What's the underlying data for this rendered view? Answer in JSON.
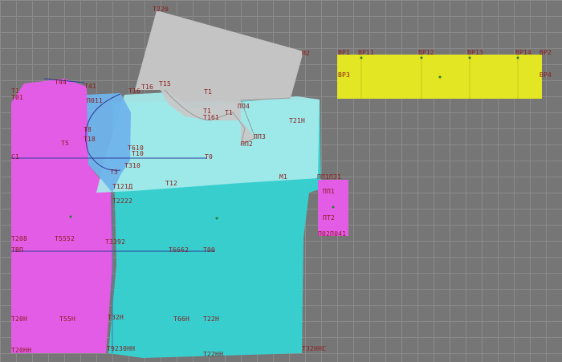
{
  "colors": {
    "background": "#767676",
    "grid": "#8a8a8a",
    "magenta_piece": "#e35ce6",
    "cyan_piece": "#35d3d3",
    "light_cyan_piece": "#a6ecec",
    "blue_piece": "#6fb4ec",
    "gray_piece": "#c8c8c8",
    "yellow_piece": "#e3e622",
    "point_label": "#8b1a1a"
  },
  "pieces": [
    {
      "id": "front-left",
      "color": "magenta"
    },
    {
      "id": "back-center",
      "color": "cyan"
    },
    {
      "id": "sleeve-overlay",
      "color": "light-cyan"
    },
    {
      "id": "armhole-region",
      "color": "blue"
    },
    {
      "id": "collar-piece",
      "color": "gray"
    },
    {
      "id": "belt-strip",
      "color": "yellow"
    },
    {
      "id": "pocket-piece",
      "color": "magenta"
    }
  ],
  "labels": {
    "t220": "Т220",
    "m2": "М2",
    "bp1": "ВР1",
    "bp11": "ВР11",
    "bp12": "ВР12",
    "bp13": "ВР13",
    "bp14": "ВР14",
    "bp2": "ВР2",
    "bp3": "ВР3",
    "bp4": "ВР4",
    "t44": "Т44",
    "t1": "Т1",
    "t01": "Т01",
    "t41": "Т41",
    "p011": "П011",
    "t16": "Т16",
    "t15": "Т15",
    "t1_right": "Т1",
    "pp4": "ПП4",
    "t1b": "Т1",
    "t161": "Т161",
    "t21h": "Т21Н",
    "pp3": "ПП3",
    "pp2": "ПП2",
    "t8": "Т8",
    "t18": "Т18",
    "t5": "Т5",
    "t610": "Т610",
    "t10": "Т10",
    "c1": "С1",
    "t0": "Т0",
    "t3": "Т3",
    "t310": "Т310",
    "m1": "М1",
    "t12": "Т12",
    "pp1_031": "ПП1П31",
    "t121d": "Т121Д",
    "pp1": "ПП1",
    "t2222": "Т2222",
    "pt2": "ПТ2",
    "t208": "Т208",
    "t5552": "Т5552",
    "t3392": "Т3392",
    "p02p041": "П02П041",
    "tbp": "ТВП",
    "t6662": "Т6662",
    "t00": "Т00",
    "t20h": "Т20Н",
    "t55h": "Т55Н",
    "t32h": "Т32Н",
    "t66h": "Т66Н",
    "t22h": "Т22Н",
    "t20hh": "Т20НН",
    "t9230hh": "Т9230НН",
    "t22hh": "Т22НН",
    "t32hhc": "Т32ННС"
  }
}
